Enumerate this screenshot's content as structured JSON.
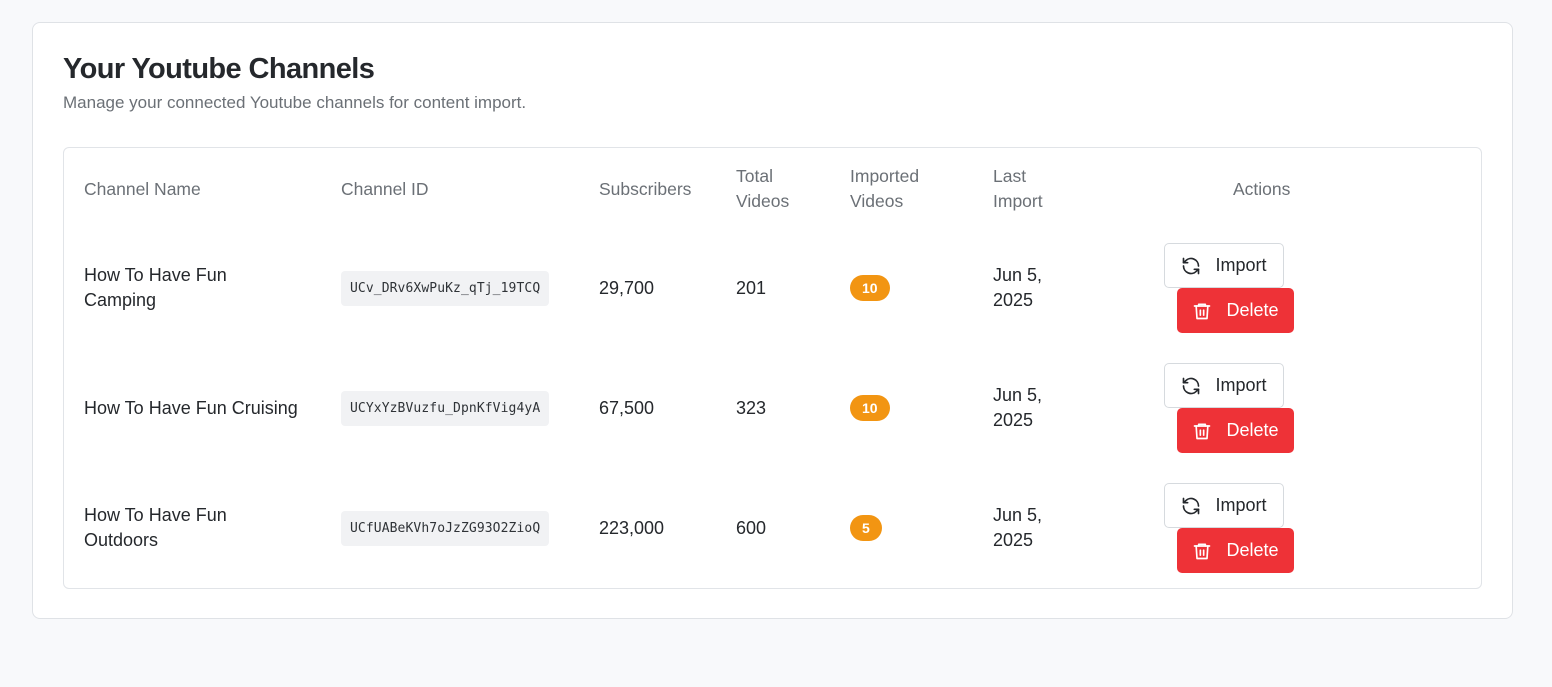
{
  "page": {
    "title": "Your Youtube Channels",
    "subtitle": "Manage your connected Youtube channels for content import."
  },
  "table": {
    "headers": {
      "channel_name": "Channel Name",
      "channel_id": "Channel ID",
      "subscribers": "Subscribers",
      "total_videos_1": "Total",
      "total_videos_2": "Videos",
      "imported_videos_1": "Imported",
      "imported_videos_2": "Videos",
      "last_import_1": "Last",
      "last_import_2": "Import",
      "actions": "Actions"
    },
    "rows": [
      {
        "name_1": "How To Have Fun",
        "name_2": "Camping",
        "channel_id": "UCv_DRv6XwPuKz_qTj_19TCQ",
        "subscribers": "29,700",
        "total_videos": "201",
        "imported_videos": "10",
        "last_import_1": "Jun 5,",
        "last_import_2": "2025",
        "import_label": "Import",
        "delete_label": "Delete"
      },
      {
        "name_1": "How To Have Fun Cruising",
        "name_2": "",
        "channel_id": "UCYxYzBVuzfu_DpnKfVig4yA",
        "subscribers": "67,500",
        "total_videos": "323",
        "imported_videos": "10",
        "last_import_1": "Jun 5,",
        "last_import_2": "2025",
        "import_label": "Import",
        "delete_label": "Delete"
      },
      {
        "name_1": "How To Have Fun",
        "name_2": "Outdoors",
        "channel_id": "UCfUABeKVh7oJzZG93O2ZioQ",
        "subscribers": "223,000",
        "total_videos": "600",
        "imported_videos": "5",
        "last_import_1": "Jun 5,",
        "last_import_2": "2025",
        "import_label": "Import",
        "delete_label": "Delete"
      }
    ]
  },
  "icons": {
    "import": "refresh-icon",
    "delete": "trash-icon"
  },
  "colors": {
    "badge": "#f29512",
    "delete": "#ee3237"
  }
}
